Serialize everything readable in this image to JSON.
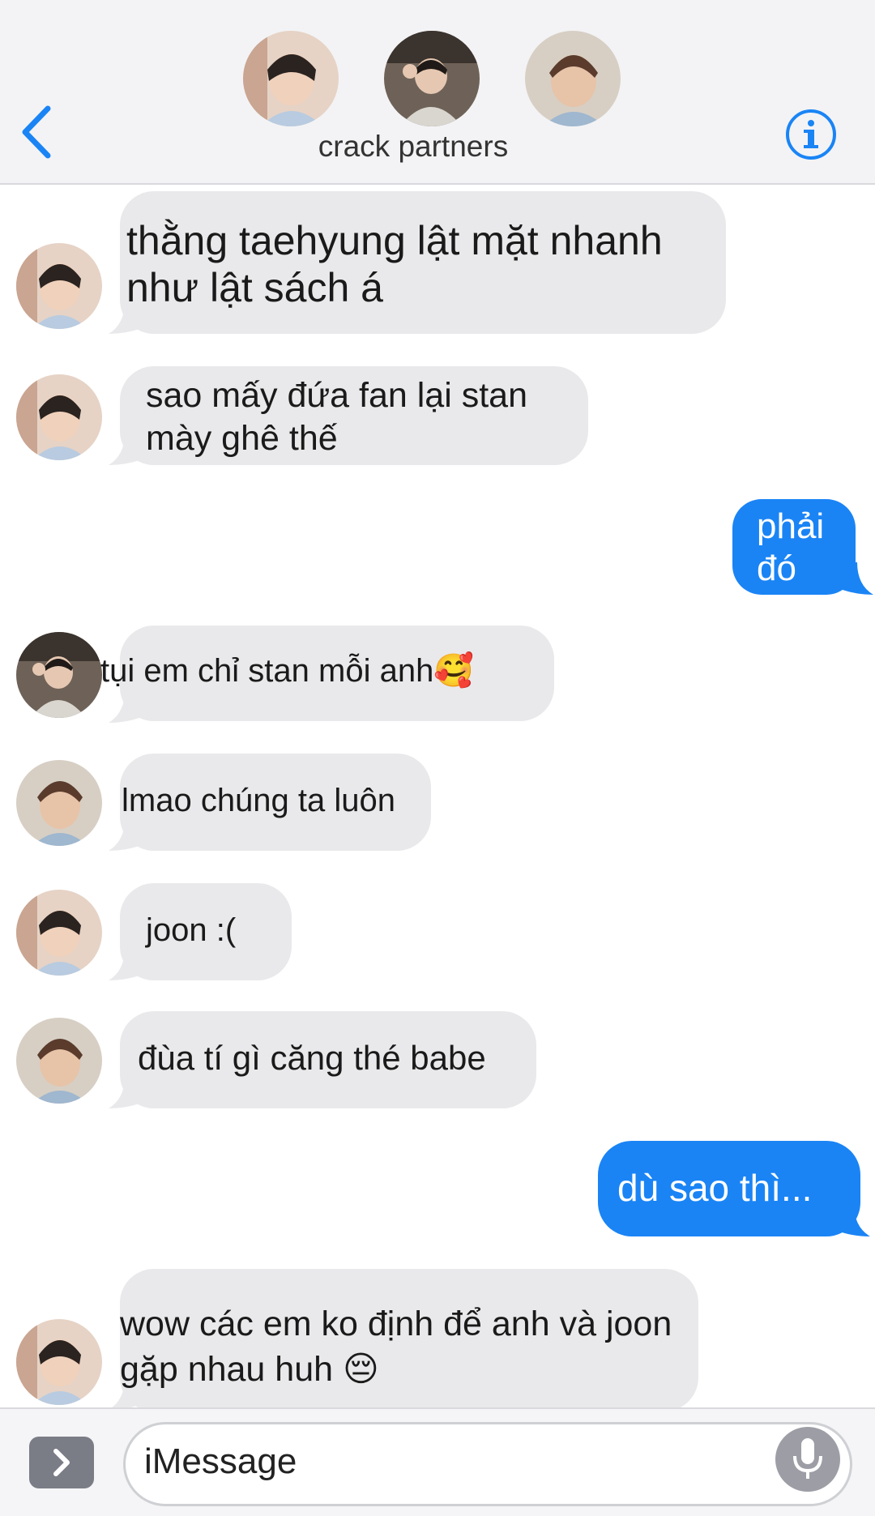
{
  "header": {
    "title": "crack partners",
    "back_icon": "chevron-left-icon",
    "info_icon": "info-icon",
    "participants": [
      "avatar-1",
      "avatar-2",
      "avatar-3"
    ]
  },
  "messages": [
    {
      "dir": "in",
      "avatar": "avatar-a",
      "lines": [
        "thằng taehyung lật mặt nhanh",
        "như lật sách á"
      ]
    },
    {
      "dir": "in",
      "avatar": "avatar-a",
      "lines": [
        "sao mấy đứa fan lại stan",
        "mày ghê thế"
      ]
    },
    {
      "dir": "out",
      "lines": [
        "phải",
        "đó"
      ]
    },
    {
      "dir": "in",
      "avatar": "avatar-b",
      "text": "tụi em chỉ stan mỗi anh",
      "emoji": "🥰"
    },
    {
      "dir": "in",
      "avatar": "avatar-c",
      "text": "lmao chúng ta luôn"
    },
    {
      "dir": "in",
      "avatar": "avatar-a",
      "text": "joon :("
    },
    {
      "dir": "in",
      "avatar": "avatar-c",
      "text": "đùa tí gì căng thé babe"
    },
    {
      "dir": "out",
      "text": "dù sao thì..."
    },
    {
      "dir": "in",
      "avatar": "avatar-a",
      "lines": [
        "wow các em ko định để anh và joon",
        "gặp nhau huh"
      ],
      "emoji": "😔"
    }
  ],
  "composer": {
    "placeholder": "iMessage",
    "apps_icon": "chevron-right-icon",
    "mic_icon": "microphone-icon"
  },
  "colors": {
    "incoming": "#e9e9eb",
    "outgoing": "#1a84f5",
    "accent": "#1a84f5"
  }
}
